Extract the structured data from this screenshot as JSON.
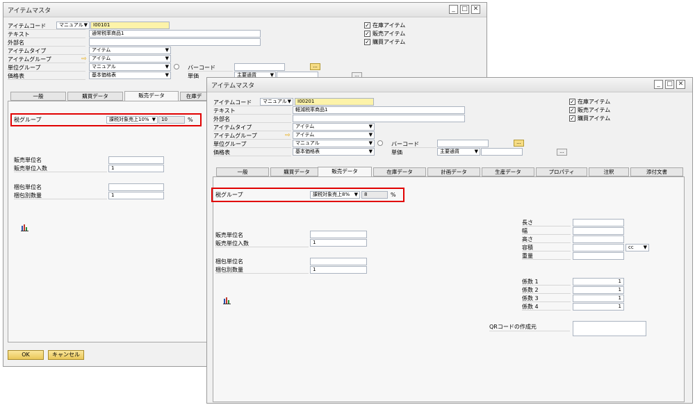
{
  "win1": {
    "title": "アイテムマスタ",
    "item_code_label": "アイテムコード",
    "series_value": "マニュアル",
    "item_code_value": "I00101",
    "text_label": "テキスト",
    "text_value": "通常税率商品1",
    "foreign_name_label": "外部名",
    "item_type_label": "アイテムタイプ",
    "item_type_value": "アイテム",
    "item_group_label": "アイテムグループ",
    "item_group_value": "アイテム",
    "uom_group_label": "単位グループ",
    "uom_group_value": "マニュアル",
    "price_list_label": "価格表",
    "price_list_value": "基本価格表",
    "barcode_label": "バーコード",
    "unit_price_label": "単価",
    "currency_value": "主要通貨",
    "checks": [
      "在庫アイテム",
      "販売アイテム",
      "購買アイテム"
    ],
    "tabs": [
      "一般",
      "購買データ",
      "販売データ",
      "在庫デ"
    ],
    "tax_group_label": "税グループ",
    "tax_group_value": "課税対象売上10%",
    "tax_rate_value": "10",
    "percent": "%",
    "sales_uom_label": "販売単位名",
    "sales_qty_label": "販売単位入数",
    "sales_qty_value": "1",
    "pack_uom_label": "梱包単位名",
    "pack_qty_label": "梱包別数量",
    "pack_qty_value": "1",
    "ok_label": "OK",
    "cancel_label": "キャンセル"
  },
  "win2": {
    "title": "アイテムマスタ",
    "item_code_label": "アイテムコード",
    "series_value": "マニュアル",
    "item_code_value": "I00201",
    "text_label": "テキスト",
    "text_value": "軽減税率商品1",
    "foreign_name_label": "外部名",
    "item_type_label": "アイテムタイプ",
    "item_type_value": "アイテム",
    "item_group_label": "アイテムグループ",
    "item_group_value": "アイテム",
    "uom_group_label": "単位グループ",
    "uom_group_value": "マニュアル",
    "price_list_label": "価格表",
    "price_list_value": "基本価格表",
    "barcode_label": "バーコード",
    "unit_price_label": "単価",
    "currency_value": "主要通貨",
    "checks": [
      "在庫アイテム",
      "販売アイテム",
      "購買アイテム"
    ],
    "tabs": [
      "一般",
      "購買データ",
      "販売データ",
      "在庫データ",
      "計画データ",
      "生産データ",
      "プロパティ",
      "注釈",
      "添付文書"
    ],
    "tax_group_label": "税グループ",
    "tax_group_value": "課税対象売上8%",
    "tax_rate_value": "8",
    "percent": "%",
    "sales_uom_label": "販売単位名",
    "sales_qty_label": "販売単位入数",
    "sales_qty_value": "1",
    "pack_uom_label": "梱包単位名",
    "pack_qty_label": "梱包別数量",
    "pack_qty_value": "1",
    "length_label": "長さ",
    "width_label": "幅",
    "height_label": "高さ",
    "volume_label": "容積",
    "volume_unit": "cc",
    "weight_label": "重量",
    "factor_labels": [
      "係数 1",
      "係数 2",
      "係数 3",
      "係数 4"
    ],
    "factor_values": [
      "1",
      "1",
      "1",
      "1"
    ],
    "qr_label": "QRコードの作成元"
  },
  "icons": {
    "arrow": "⇨",
    "chart": "chart-icon",
    "info": "info-icon"
  }
}
